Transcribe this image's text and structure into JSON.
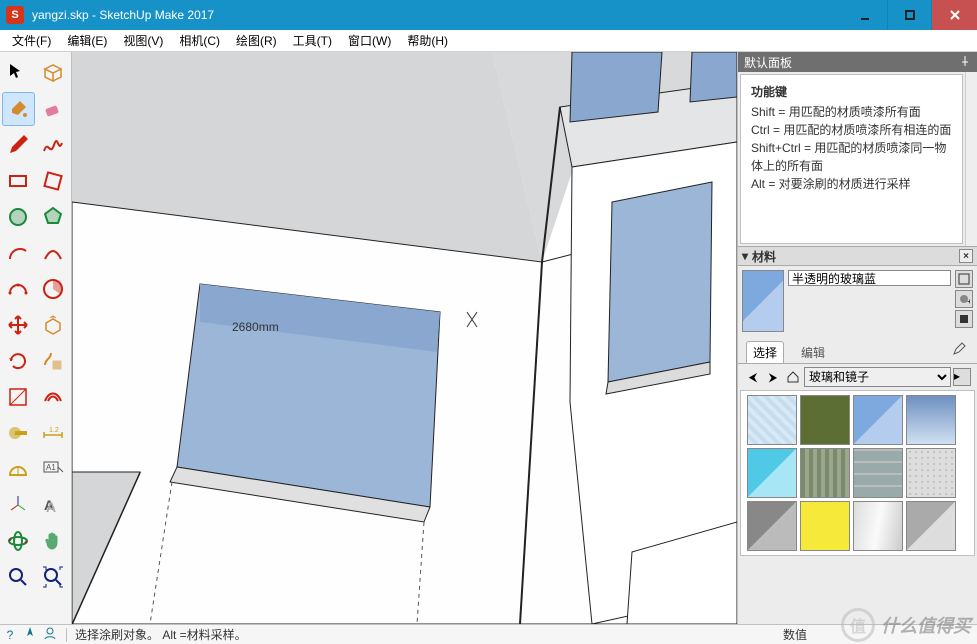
{
  "window": {
    "title": "yangzi.skp - SketchUp Make 2017",
    "app_glyph": "S"
  },
  "menu": {
    "items": [
      "文件(F)",
      "编辑(E)",
      "视图(V)",
      "相机(C)",
      "绘图(R)",
      "工具(T)",
      "窗口(W)",
      "帮助(H)"
    ]
  },
  "tools": [
    {
      "name": "select-tool",
      "glyph": "arrow",
      "color": "#000"
    },
    {
      "name": "component-tool",
      "glyph": "box",
      "color": "#d38b2e"
    },
    {
      "name": "paint-bucket-tool",
      "glyph": "bucket",
      "color": "#d38b2e",
      "active": true
    },
    {
      "name": "eraser-tool",
      "glyph": "eraser",
      "color": "#e37ca0"
    },
    {
      "name": "line-tool",
      "glyph": "pencil",
      "color": "#c21"
    },
    {
      "name": "freehand-tool",
      "glyph": "squiggle",
      "color": "#c21"
    },
    {
      "name": "rectangle-tool",
      "glyph": "rect",
      "color": "#c21"
    },
    {
      "name": "rotated-rect-tool",
      "glyph": "rrect",
      "color": "#c21"
    },
    {
      "name": "circle-tool",
      "glyph": "circle",
      "color": "#1a8a3a"
    },
    {
      "name": "polygon-tool",
      "glyph": "poly",
      "color": "#1a8a3a"
    },
    {
      "name": "arc-tool",
      "glyph": "arc",
      "color": "#c21"
    },
    {
      "name": "two-point-arc-tool",
      "glyph": "arc2",
      "color": "#c21"
    },
    {
      "name": "three-point-arc-tool",
      "glyph": "arc3",
      "color": "#c21"
    },
    {
      "name": "pie-tool",
      "glyph": "pie",
      "color": "#c21"
    },
    {
      "name": "move-tool",
      "glyph": "move",
      "color": "#c21"
    },
    {
      "name": "pushpull-tool",
      "glyph": "push",
      "color": "#d38b2e"
    },
    {
      "name": "rotate-tool",
      "glyph": "rotate",
      "color": "#c21"
    },
    {
      "name": "followme-tool",
      "glyph": "follow",
      "color": "#d38b2e"
    },
    {
      "name": "scale-tool",
      "glyph": "scale",
      "color": "#c21"
    },
    {
      "name": "offset-tool",
      "glyph": "offset",
      "color": "#c21"
    },
    {
      "name": "tape-tool",
      "glyph": "tape",
      "color": "#caa21a"
    },
    {
      "name": "dimension-tool",
      "glyph": "dim",
      "color": "#caa21a"
    },
    {
      "name": "protractor-tool",
      "glyph": "prot",
      "color": "#caa21a"
    },
    {
      "name": "text-tool",
      "glyph": "text",
      "color": "#555"
    },
    {
      "name": "axes-tool",
      "glyph": "axes",
      "color": "#127"
    },
    {
      "name": "3dtext-tool",
      "glyph": "3dt",
      "color": "#555"
    },
    {
      "name": "orbit-tool",
      "glyph": "orbit",
      "color": "#1a8a3a"
    },
    {
      "name": "pan-tool",
      "glyph": "pan",
      "color": "#1a8a3a"
    },
    {
      "name": "zoom-tool",
      "glyph": "zoom",
      "color": "#127"
    },
    {
      "name": "zoom-extents-tool",
      "glyph": "zoome",
      "color": "#127"
    }
  ],
  "viewport": {
    "dimension_label": "2680mm"
  },
  "tray": {
    "title": "默认面板",
    "help": {
      "heading": "功能键",
      "lines": [
        "Shift = 用匹配的材质喷漆所有面",
        "Ctrl = 用匹配的材质喷漆所有相连的面",
        "Shift+Ctrl = 用匹配的材质喷漆同一物体上的所有面",
        "Alt = 对要涂刷的材质进行采样"
      ]
    },
    "materials": {
      "section_title": "材料",
      "current_name": "半透明的玻璃蓝",
      "tab_select": "选择",
      "tab_edit": "编辑",
      "library": "玻璃和镜子",
      "swatches": [
        {
          "name": "glass-frosted",
          "css": "repeating-linear-gradient(45deg,#d8e9f5 0 4px,#c4ddef 4px 8px)"
        },
        {
          "name": "green-solid",
          "css": "#5c6e33"
        },
        {
          "name": "glass-blue-trans",
          "css": "linear-gradient(135deg,#7da9de 0 50%,#b4cdee 50% 100%)"
        },
        {
          "name": "sky-clouds",
          "css": "linear-gradient(#6e8fc0,#cfe0f2)"
        },
        {
          "name": "glass-cyan",
          "css": "linear-gradient(135deg,#4fc9e6 0 50%,#a7e6f4 50% 100%)"
        },
        {
          "name": "corrugated",
          "css": "repeating-linear-gradient(90deg,#7a8a6d 0 4px,#9aa78c 4px 8px)"
        },
        {
          "name": "glass-block",
          "css": "repeating-linear-gradient(0deg,#9aa 0 10px,#bbb 10px 12px),repeating-linear-gradient(90deg,#9aa 0 10px,#bbb 10px 12px)"
        },
        {
          "name": "granite",
          "css": "radial-gradient(#bbb 20%,#ddd 21%) 0 0/6px 6px,#ccc"
        },
        {
          "name": "glass-grey",
          "css": "linear-gradient(135deg,#888 0 50%,#bbb 50% 100%)"
        },
        {
          "name": "yellow-solid",
          "css": "#f6e93a"
        },
        {
          "name": "mirror",
          "css": "linear-gradient(100deg,#ddd,#fafafa,#ccc)"
        },
        {
          "name": "grey-trans",
          "css": "linear-gradient(135deg,#aaa 0 50%,#ddd 50% 100%)"
        }
      ]
    }
  },
  "statusbar": {
    "hint": "选择涂刷对象。 Alt =材料采样。",
    "value_label": "数值"
  },
  "watermark": {
    "text": "什么值得买",
    "bubble": "值"
  }
}
